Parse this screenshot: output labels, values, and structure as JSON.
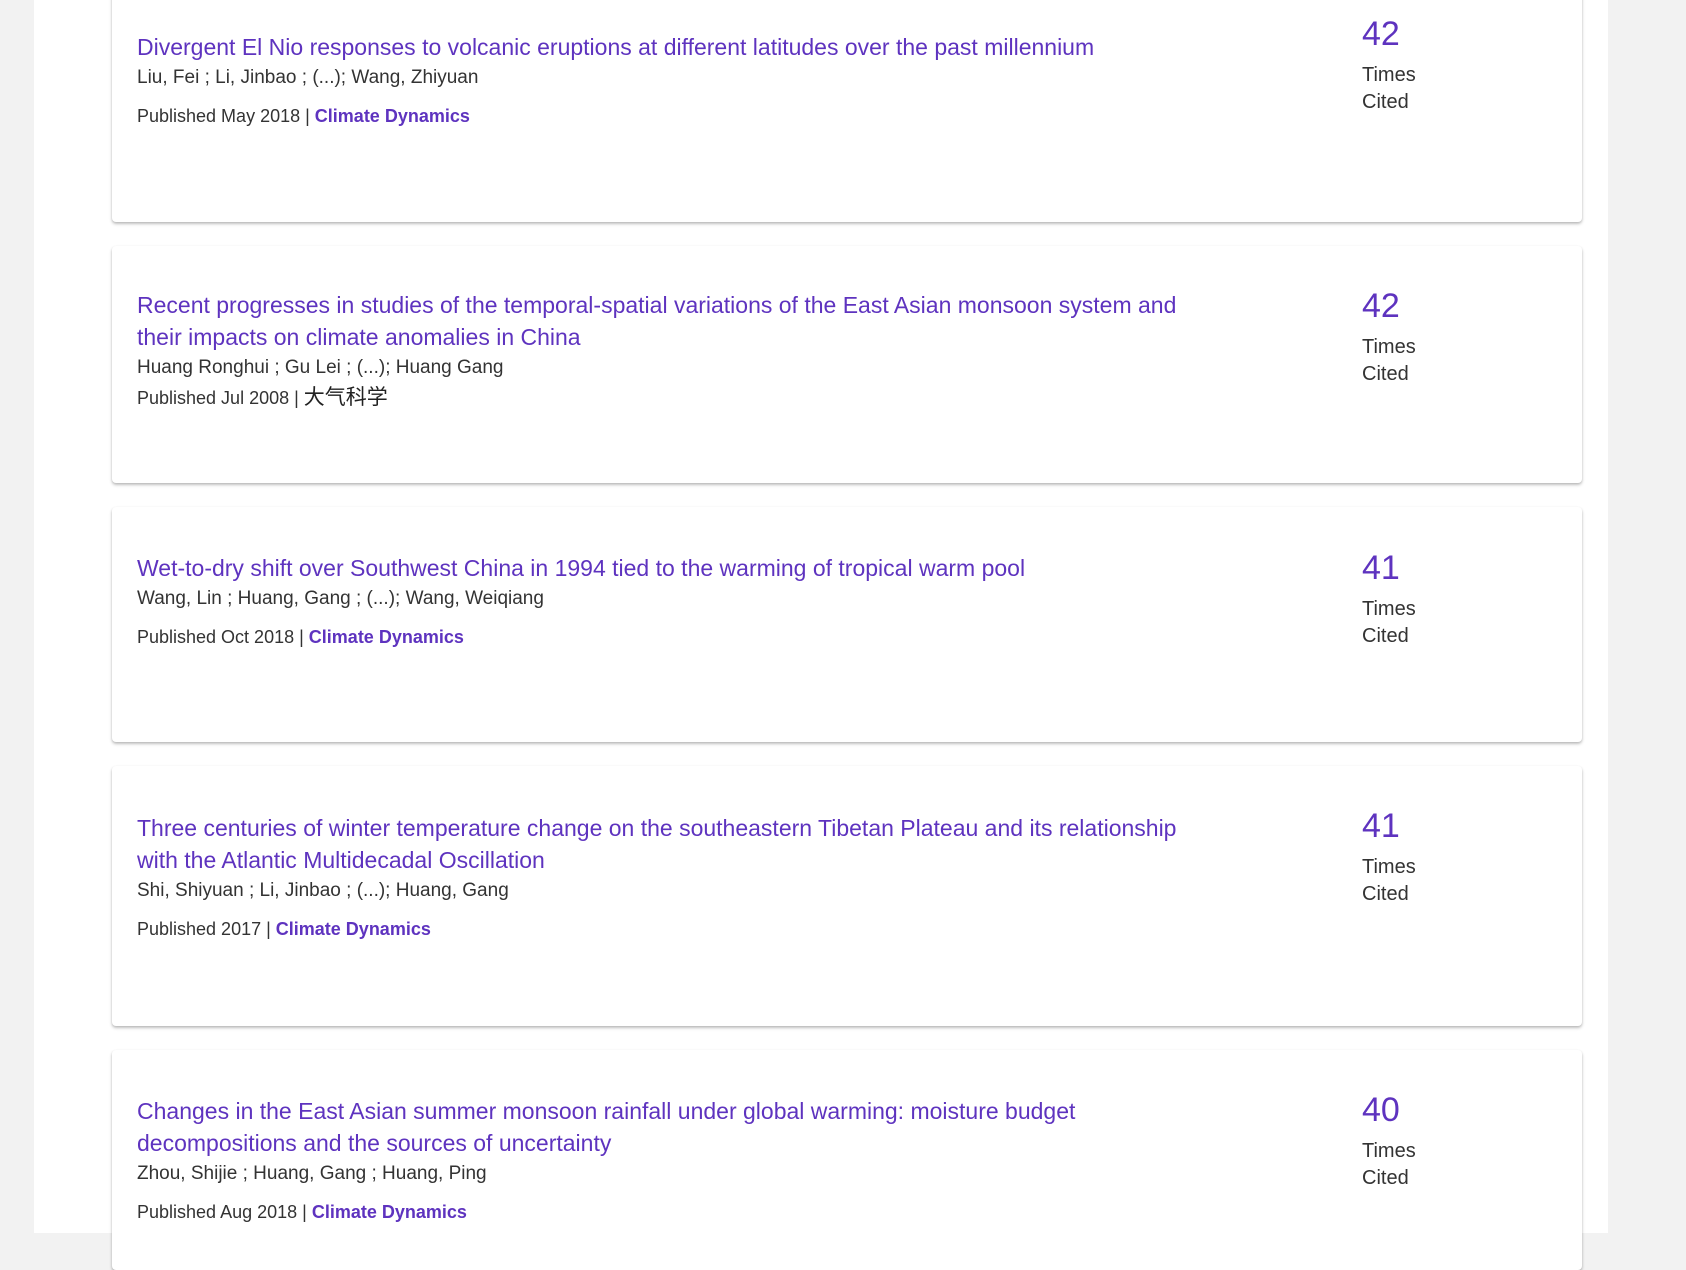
{
  "records": [
    {
      "title": "Divergent El Nio responses to volcanic eruptions at different latitudes over the past millennium",
      "authors": "Liu, Fei ; Li, Jinbao ; (...); Wang, Zhiyuan",
      "published": "Published May 2018 | ",
      "journal": "Climate Dynamics",
      "times_cited": "42",
      "cited_label": "Times Cited"
    },
    {
      "title": "Recent progresses in studies of the temporal-spatial variations of the East Asian monsoon system and their impacts on climate anomalies in China",
      "authors": "Huang Ronghui ; Gu Lei ; (...); Huang Gang",
      "published": "Published Jul 2008 | ",
      "journal": "大气科学",
      "times_cited": "42",
      "cited_label": "Times Cited"
    },
    {
      "title": "Wet-to-dry shift over Southwest China in 1994 tied to the warming of tropical warm pool",
      "authors": "Wang, Lin ; Huang, Gang ; (...); Wang, Weiqiang",
      "published": "Published Oct 2018 | ",
      "journal": "Climate Dynamics",
      "times_cited": "41",
      "cited_label": "Times Cited"
    },
    {
      "title": "Three centuries of winter temperature change on the southeastern Tibetan Plateau and its relationship with the Atlantic Multidecadal Oscillation",
      "authors": "Shi, Shiyuan ; Li, Jinbao ; (...); Huang, Gang",
      "published": "Published 2017 | ",
      "journal": "Climate Dynamics",
      "times_cited": "41",
      "cited_label": "Times Cited"
    },
    {
      "title": "Changes in the East Asian summer monsoon rainfall under global warming: moisture budget decompositions and the sources of uncertainty",
      "authors": "Zhou, Shijie ; Huang, Gang ; Huang, Ping",
      "published": "Published Aug 2018 | ",
      "journal": "Climate Dynamics",
      "times_cited": "40",
      "cited_label": "Times Cited"
    }
  ],
  "colors": {
    "accent": "#5e33bf",
    "text": "#333333",
    "page_bg": "#f2f2f2",
    "card_bg": "#ffffff"
  }
}
